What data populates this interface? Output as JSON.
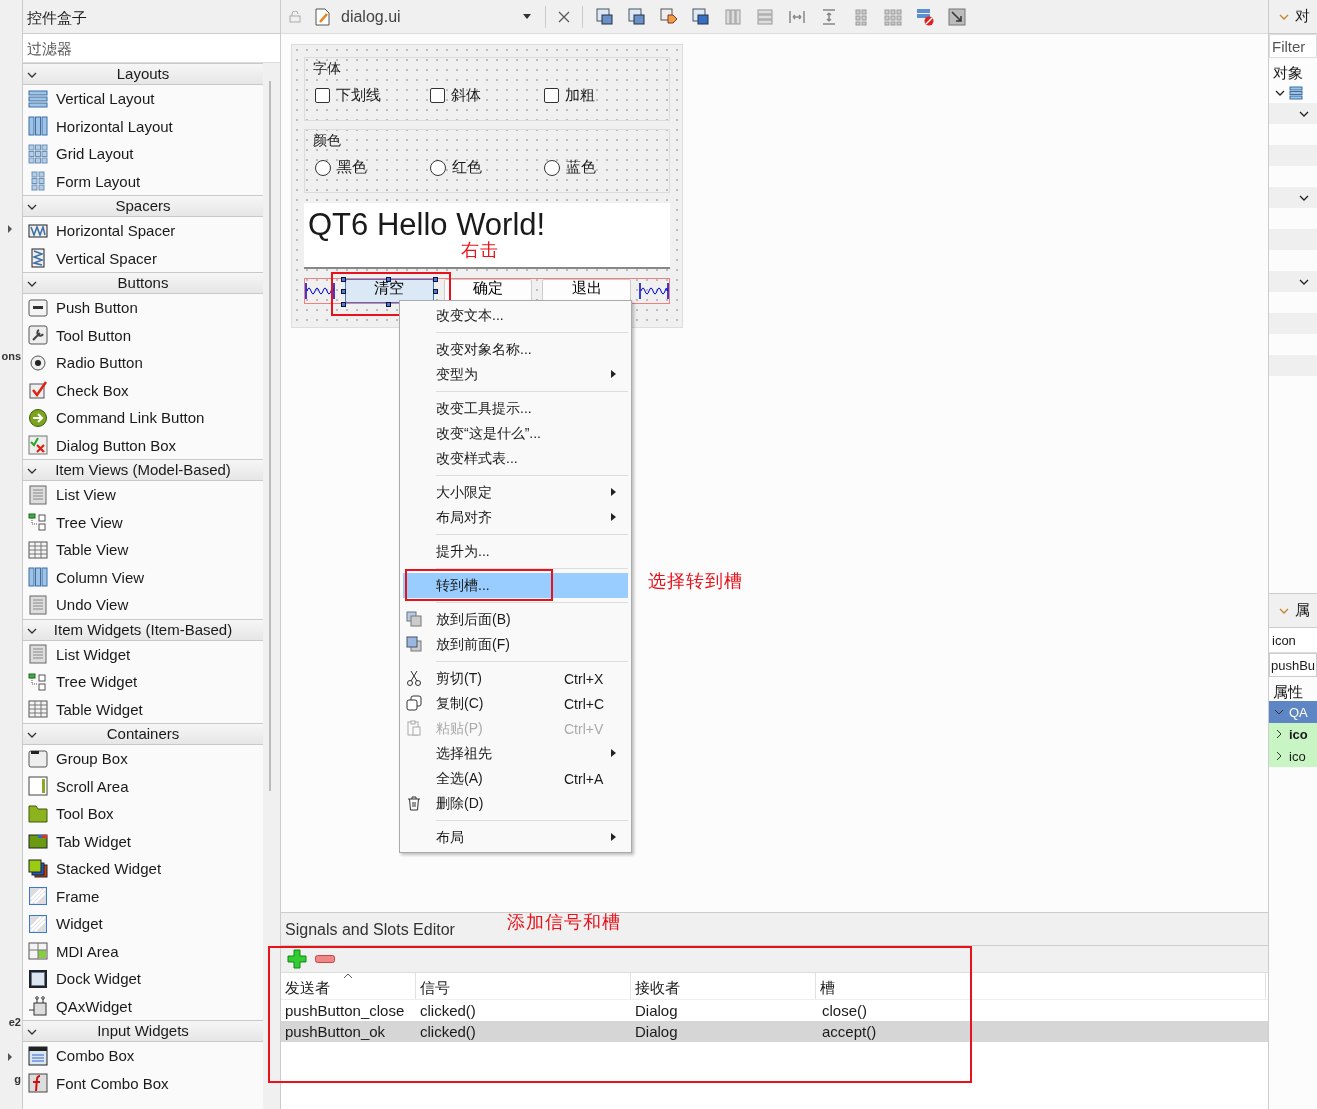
{
  "left_edge": [
    "ons",
    "e2",
    "g"
  ],
  "widget_box": {
    "title": "控件盒子",
    "filter": {
      "placeholder": "过滤器"
    },
    "categories": [
      {
        "name": "Layouts",
        "expanded": true,
        "items": [
          "Vertical Layout",
          "Horizontal Layout",
          "Grid Layout",
          "Form Layout"
        ]
      },
      {
        "name": "Spacers",
        "expanded": true,
        "items": [
          "Horizontal Spacer",
          "Vertical Spacer"
        ]
      },
      {
        "name": "Buttons",
        "expanded": true,
        "items": [
          "Push Button",
          "Tool Button",
          "Radio Button",
          "Check Box",
          "Command Link Button",
          "Dialog Button Box"
        ]
      },
      {
        "name": "Item Views (Model-Based)",
        "expanded": true,
        "items": [
          "List View",
          "Tree View",
          "Table View",
          "Column View",
          "Undo View"
        ]
      },
      {
        "name": "Item Widgets (Item-Based)",
        "expanded": true,
        "items": [
          "List Widget",
          "Tree Widget",
          "Table Widget"
        ]
      },
      {
        "name": "Containers",
        "expanded": true,
        "items": [
          "Group Box",
          "Scroll Area",
          "Tool Box",
          "Tab Widget",
          "Stacked Widget",
          "Frame",
          "Widget",
          "MDI Area",
          "Dock Widget",
          "QAxWidget"
        ]
      },
      {
        "name": "Input Widgets",
        "expanded": true,
        "items": [
          "Combo Box",
          "Font Combo Box"
        ]
      }
    ]
  },
  "document": {
    "file": "dialog.ui"
  },
  "form": {
    "groups": [
      {
        "title": "字体",
        "kind": "checkbox",
        "options": [
          {
            "label": "下划线",
            "checked": false
          },
          {
            "label": "斜体",
            "checked": false
          },
          {
            "label": "加粗",
            "checked": false
          }
        ]
      },
      {
        "title": "颜色",
        "kind": "radio",
        "options": [
          {
            "label": "黑色",
            "selected": false
          },
          {
            "label": "红色",
            "selected": false
          },
          {
            "label": "蓝色",
            "selected": false
          }
        ]
      }
    ],
    "label": "QT6 Hello World!",
    "buttons": [
      {
        "label": "清空",
        "selected": true
      },
      {
        "label": "确定",
        "selected": false
      },
      {
        "label": "退出",
        "selected": false
      }
    ]
  },
  "context_menu": {
    "sections": [
      [
        {
          "label": "改变文本...",
          "submenu": false,
          "disabled": false,
          "selected": false
        }
      ],
      [
        {
          "label": "改变对象名称...",
          "submenu": false,
          "disabled": false,
          "selected": false
        },
        {
          "label": "变型为",
          "submenu": true,
          "disabled": false,
          "selected": false
        }
      ],
      [
        {
          "label": "改变工具提示...",
          "submenu": false,
          "disabled": false,
          "selected": false
        },
        {
          "label": "改变“这是什么”...",
          "submenu": false,
          "disabled": false,
          "selected": false
        },
        {
          "label": "改变样式表...",
          "submenu": false,
          "disabled": false,
          "selected": false
        }
      ],
      [
        {
          "label": "大小限定",
          "submenu": true,
          "disabled": false,
          "selected": false
        },
        {
          "label": "布局对齐",
          "submenu": true,
          "disabled": false,
          "selected": false
        }
      ],
      [
        {
          "label": "提升为...",
          "submenu": false,
          "disabled": false,
          "selected": false
        }
      ],
      [
        {
          "label": "转到槽...",
          "submenu": false,
          "disabled": false,
          "selected": true
        }
      ],
      [
        {
          "label": "放到后面(B)",
          "submenu": false,
          "disabled": false,
          "selected": false
        },
        {
          "label": "放到前面(F)",
          "submenu": false,
          "disabled": false,
          "selected": false
        }
      ],
      [
        {
          "label": "剪切(T)",
          "shortcut": "Ctrl+X",
          "submenu": false,
          "disabled": false,
          "selected": false
        },
        {
          "label": "复制(C)",
          "shortcut": "Ctrl+C",
          "submenu": false,
          "disabled": false,
          "selected": false
        },
        {
          "label": "粘贴(P)",
          "shortcut": "Ctrl+V",
          "submenu": false,
          "disabled": true,
          "selected": false
        },
        {
          "label": "选择祖先",
          "submenu": true,
          "disabled": false,
          "selected": false
        },
        {
          "label": "全选(A)",
          "shortcut": "Ctrl+A",
          "submenu": false,
          "disabled": false,
          "selected": false
        },
        {
          "label": "删除(D)",
          "submenu": false,
          "disabled": false,
          "selected": false
        }
      ],
      [
        {
          "label": "布局",
          "submenu": true,
          "disabled": false,
          "selected": false
        }
      ]
    ]
  },
  "annotations": [
    "右击",
    "选择转到槽",
    "添加信号和槽"
  ],
  "signals_slots_editor": {
    "title": "Signals and Slots Editor",
    "columns": [
      {
        "label": "发送者",
        "sorted": true
      },
      {
        "label": "信号",
        "sorted": false
      },
      {
        "label": "接收者",
        "sorted": false
      },
      {
        "label": "槽",
        "sorted": false
      }
    ],
    "rows": [
      {
        "cells": [
          "pushButton_close",
          "clicked()",
          "Dialog",
          "close()"
        ],
        "selected": false
      },
      {
        "cells": [
          "pushButton_ok",
          "clicked()",
          "Dialog",
          "accept()"
        ],
        "selected": true
      }
    ]
  },
  "object_inspector": {
    "title": "对",
    "filter": {
      "placeholder": "Filter"
    },
    "column": "对象"
  },
  "property_editor": {
    "title": "属",
    "filter_value": "icon",
    "object": "pushBu",
    "column": "属性",
    "rows": [
      {
        "text": "QA",
        "kind": "class",
        "modified": false
      },
      {
        "text": "ico",
        "kind": "property",
        "modified": true
      },
      {
        "text": "ico",
        "kind": "property",
        "modified": false
      }
    ]
  }
}
